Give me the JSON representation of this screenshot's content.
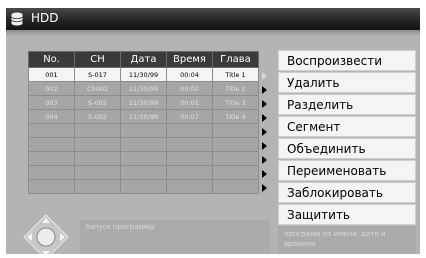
{
  "window": {
    "title": "HDD",
    "icon": "hdd-icon"
  },
  "table": {
    "columns": [
      "No.",
      "CH",
      "Дата",
      "Время",
      "Глава"
    ],
    "rows": [
      [
        "001",
        "S-017",
        "11/30/99",
        "00:04",
        "Title 1"
      ],
      [
        "002",
        "Ch002",
        "11/30/99",
        "00:00",
        "Title 2"
      ],
      [
        "003",
        "S-002",
        "11/30/99",
        "00:01",
        "Title 3"
      ],
      [
        "004",
        "S-002",
        "11/30/99",
        "00:07",
        "Title 4"
      ]
    ],
    "empty_rows": 5,
    "selected_row": 0
  },
  "menu": {
    "items": [
      "Воспроизвести",
      "Удалить",
      "Разделить",
      "Сегмент",
      "Объединить",
      "Переименовать",
      "Заблокировать",
      "Защитить"
    ],
    "help": "программ по имени, дате и времени"
  },
  "description": "Запуск программы",
  "colors": {
    "header": "#3a3a3a",
    "selected_row": "#f4f4f4",
    "dim_row": "#a6a6a6",
    "menu_item": "#f4f4f4"
  },
  "icons": [
    "hdd-icon",
    "dpad-icon",
    "arrow-right-icon"
  ]
}
